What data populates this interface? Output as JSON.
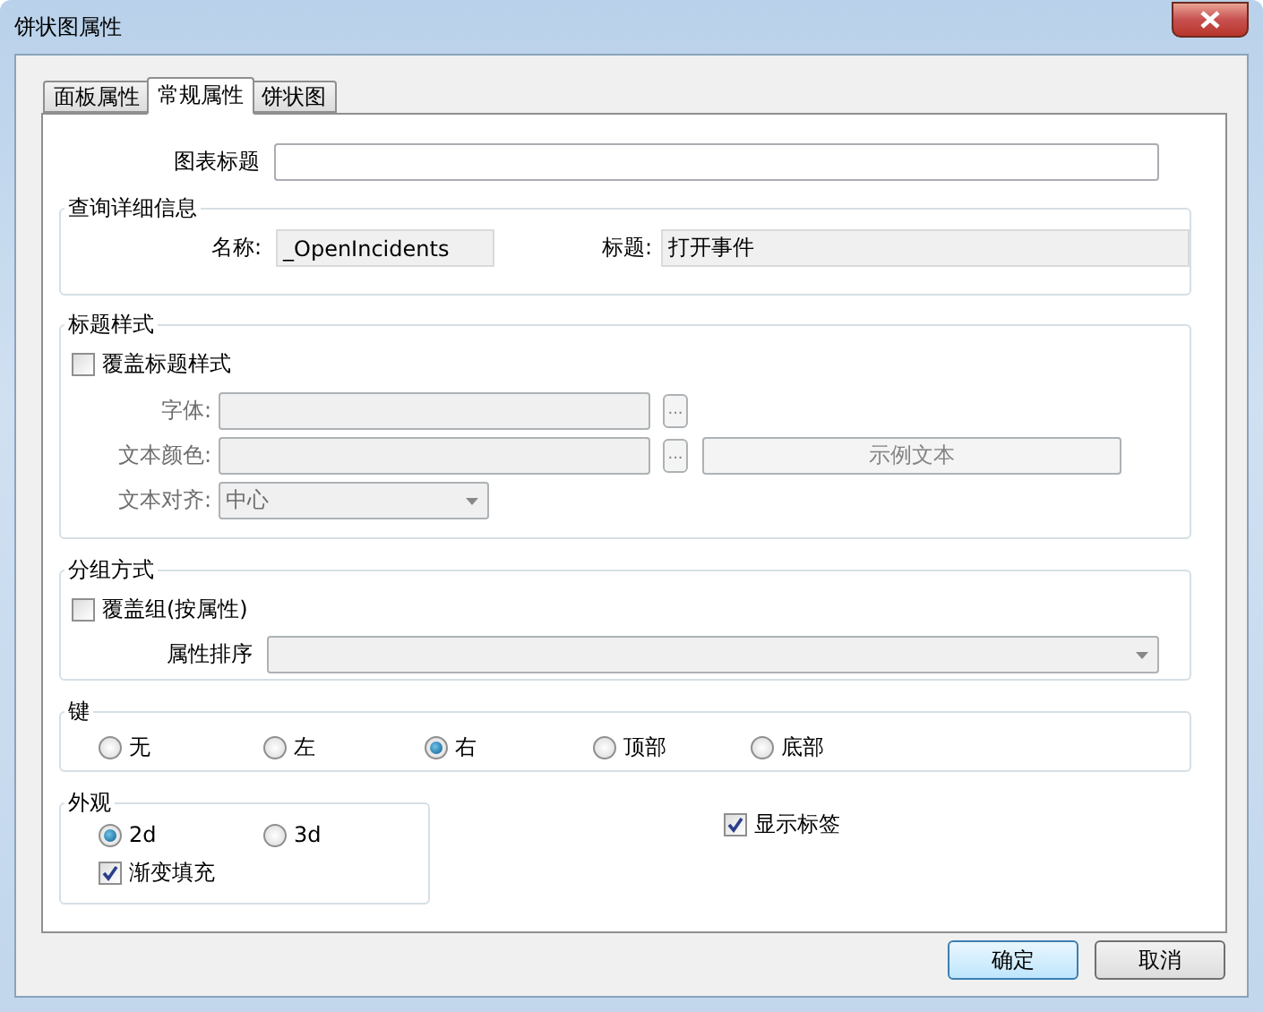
{
  "window": {
    "title": "饼状图属性"
  },
  "tabs": [
    {
      "label": "面板属性",
      "selected": false
    },
    {
      "label": "常规属性",
      "selected": true
    },
    {
      "label": "饼状图",
      "selected": false
    }
  ],
  "chart_title": {
    "label": "图表标题"
  },
  "query_details": {
    "legend": "查询详细信息",
    "fields": [
      {
        "label": "名称:",
        "value": "_OpenIncidents"
      },
      {
        "label": "标题:",
        "value": "打开事件"
      }
    ]
  },
  "title_style": {
    "legend": "标题样式",
    "override": {
      "label": "覆盖标题样式",
      "checked": false
    },
    "rows": [
      {
        "kind": "text",
        "label": "字体:",
        "browse": "...",
        "disabled": true
      },
      {
        "kind": "color",
        "label": "文本颜色:",
        "browse": "...",
        "sample": "示例文本",
        "disabled": true
      },
      {
        "kind": "select",
        "label": "文本对齐:",
        "value": "中心",
        "disabled": true
      }
    ]
  },
  "grouping": {
    "legend": "分组方式",
    "override": {
      "label": "覆盖组(按属性)",
      "checked": false
    },
    "sort": {
      "label": "属性排序",
      "disabled": true
    }
  },
  "legend_position": {
    "legend": "键",
    "options": [
      {
        "label": "无",
        "selected": false
      },
      {
        "label": "左",
        "selected": false
      },
      {
        "label": "右",
        "selected": true
      },
      {
        "label": "顶部",
        "selected": false
      },
      {
        "label": "底部",
        "selected": false
      }
    ]
  },
  "appearance": {
    "legend": "外观",
    "options": [
      {
        "label": "2d",
        "selected": true
      },
      {
        "label": "3d",
        "selected": false
      }
    ],
    "gradient": {
      "label": "渐变填充",
      "checked": true
    }
  },
  "show_labels": {
    "label": "显示标签",
    "checked": true
  },
  "buttons": [
    {
      "label": "确定",
      "default": true
    },
    {
      "label": "取消",
      "default": false
    }
  ]
}
